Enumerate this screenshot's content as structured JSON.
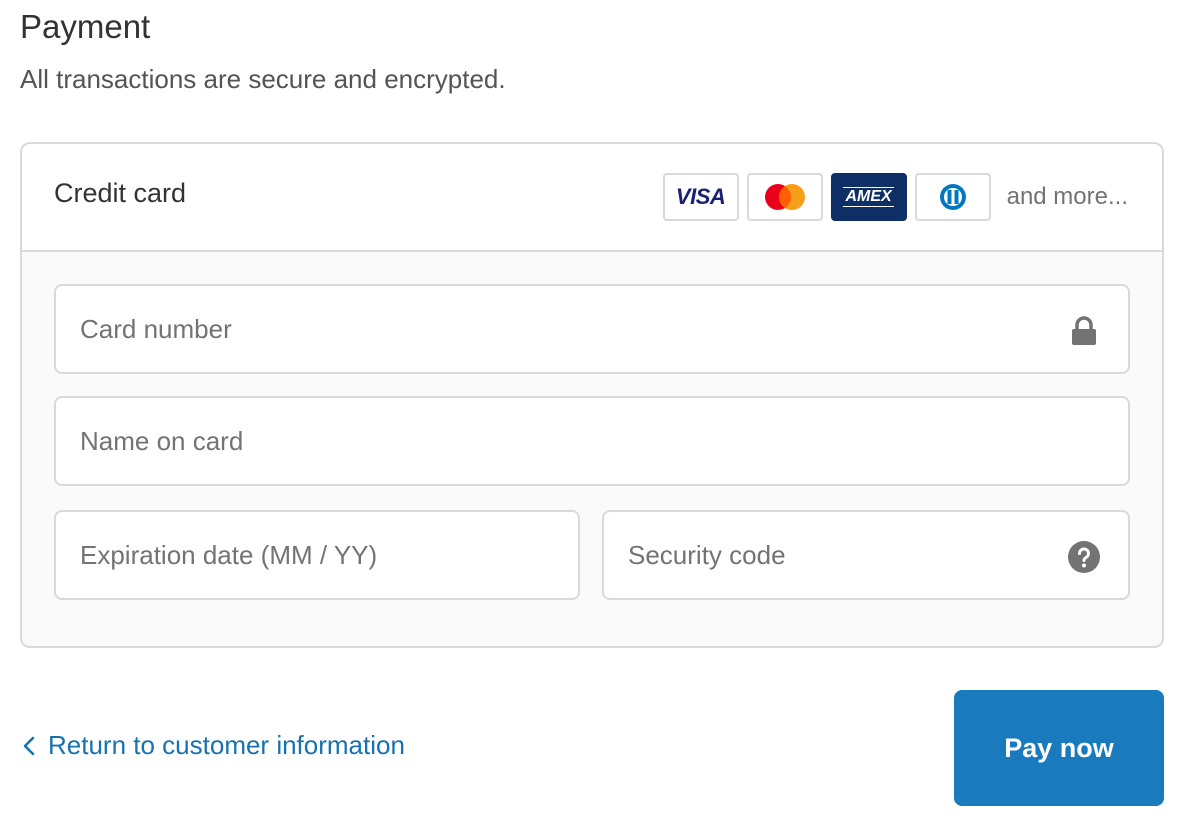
{
  "header": {
    "title": "Payment",
    "subtitle": "All transactions are secure and encrypted."
  },
  "payment_method": {
    "label": "Credit card",
    "brands": [
      {
        "name": "visa-icon",
        "text": "VISA"
      },
      {
        "name": "mastercard-icon",
        "text": ""
      },
      {
        "name": "amex-icon",
        "text": "AMEX"
      },
      {
        "name": "diners-club-icon",
        "text": ""
      }
    ],
    "more_text": "and more..."
  },
  "form": {
    "card_number": {
      "placeholder": "Card number",
      "value": "",
      "icon": "lock-icon"
    },
    "name_on_card": {
      "placeholder": "Name on card",
      "value": ""
    },
    "expiration": {
      "placeholder": "Expiration date (MM / YY)",
      "value": ""
    },
    "security_code": {
      "placeholder": "Security code",
      "value": "",
      "icon": "help-icon"
    }
  },
  "footer": {
    "back_link": "Return to customer information",
    "pay_button": "Pay now"
  },
  "colors": {
    "accent": "#197bbd",
    "link": "#1773b0",
    "border": "#d9d9d9",
    "panel_bg": "#fafafa",
    "amex_bg": "#0e2f66",
    "visa_text": "#1a1f71",
    "mastercard_red": "#eb001b",
    "mastercard_orange": "#f79e1b",
    "diners_blue": "#0079be"
  }
}
